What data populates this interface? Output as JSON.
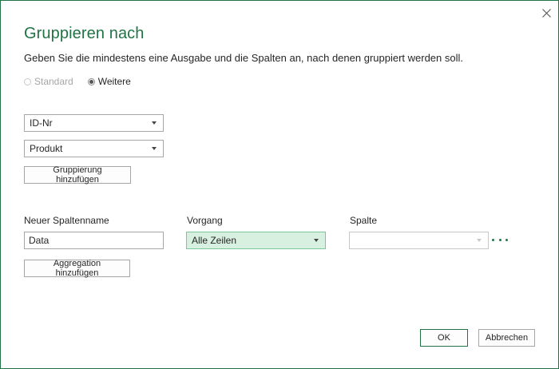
{
  "dialog": {
    "title": "Gruppieren nach",
    "description": "Geben Sie die mindestens eine Ausgabe und die Spalten an, nach denen gruppiert werden soll.",
    "mode": {
      "standard_label": "Standard",
      "advanced_label": "Weitere",
      "selected": "Weitere"
    },
    "group_by": {
      "columns": [
        "ID-Nr",
        "Produkt"
      ],
      "add_button": "Gruppierung hinzufügen"
    },
    "aggregation": {
      "headers": {
        "new_column_name": "Neuer Spaltenname",
        "operation": "Vorgang",
        "column": "Spalte"
      },
      "rows": [
        {
          "new_column_name": "Data",
          "operation": "Alle Zeilen",
          "column": ""
        }
      ],
      "add_button": "Aggregation hinzufügen"
    },
    "ok_label": "OK",
    "cancel_label": "Abbrechen"
  },
  "colors": {
    "accent": "#217346",
    "active_select_bg": "#d7f0df"
  },
  "icons": {
    "close": "close-icon",
    "more": "more-options-icon",
    "dropdown": "chevron-down-icon"
  }
}
